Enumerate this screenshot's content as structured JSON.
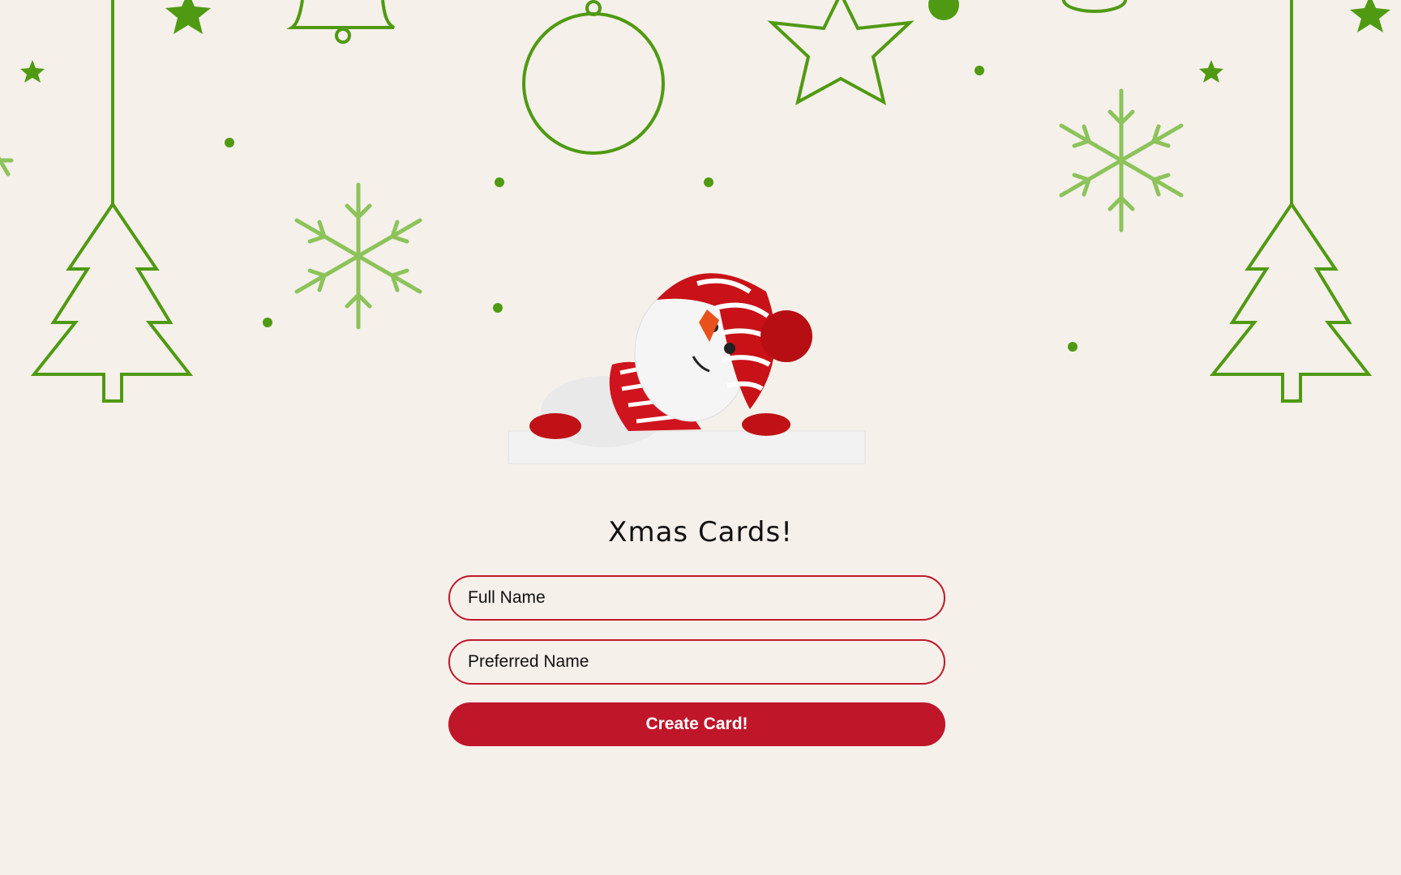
{
  "page": {
    "title": "Xmas Cards!"
  },
  "form": {
    "full_name_placeholder": "Full Name",
    "preferred_name_placeholder": "Preferred Name",
    "submit_label": "Create Card!"
  },
  "colors": {
    "background": "#f5f0ea",
    "decor_green": "#4f9a12",
    "accent_red": "#c0162a"
  }
}
